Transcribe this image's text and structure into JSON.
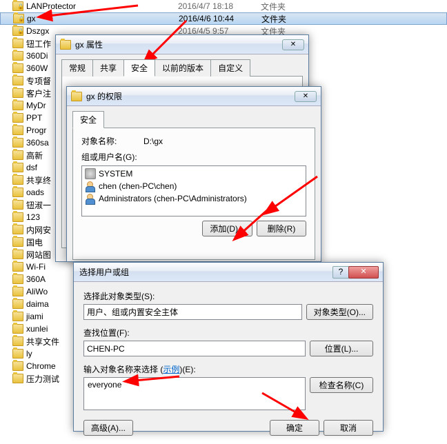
{
  "files": [
    {
      "name": "LANProtector",
      "date": "2016/4/7 18:18",
      "type": "文件夹",
      "locked": true
    },
    {
      "name": "gx",
      "date": "2016/4/6 10:44",
      "type": "文件夹",
      "selected": true,
      "locked": true
    },
    {
      "name": "Dszgx",
      "date": "2016/4/5 9:57",
      "type": "文件夹",
      "locked": true
    },
    {
      "name": "钮工作",
      "date": "",
      "type": ""
    },
    {
      "name": "360Di",
      "date": "",
      "type": ""
    },
    {
      "name": "360W",
      "date": "",
      "type": ""
    },
    {
      "name": "专项督",
      "date": "",
      "type": ""
    },
    {
      "name": "客户注",
      "date": "",
      "type": ""
    },
    {
      "name": "MyDr",
      "date": "",
      "type": ""
    },
    {
      "name": "PPT",
      "date": "",
      "type": ""
    },
    {
      "name": "Progr",
      "date": "",
      "type": ""
    },
    {
      "name": "360sa",
      "date": "",
      "type": ""
    },
    {
      "name": "高新",
      "date": "",
      "type": ""
    },
    {
      "name": "dsf",
      "date": "",
      "type": ""
    },
    {
      "name": "共享终",
      "date": "",
      "type": ""
    },
    {
      "name": "oads",
      "date": "",
      "type": ""
    },
    {
      "name": "钮淑一",
      "date": "",
      "type": ""
    },
    {
      "name": "123",
      "date": "",
      "type": ""
    },
    {
      "name": "内网安",
      "date": "",
      "type": ""
    },
    {
      "name": "国电",
      "date": "",
      "type": ""
    },
    {
      "name": "网站图",
      "date": "",
      "type": ""
    },
    {
      "name": "Wi-Fi",
      "date": "",
      "type": ""
    },
    {
      "name": "360A",
      "date": "",
      "type": ""
    },
    {
      "name": "AliWo",
      "date": "",
      "type": ""
    },
    {
      "name": "daima",
      "date": "",
      "type": ""
    },
    {
      "name": "jiami",
      "date": "",
      "type": ""
    },
    {
      "name": "xunlei",
      "date": "",
      "type": ""
    },
    {
      "name": "共享文件",
      "date": "",
      "type": ""
    },
    {
      "name": "ly",
      "date": "",
      "type": ""
    },
    {
      "name": "Chrome",
      "date": "",
      "type": ""
    },
    {
      "name": "压力测试",
      "date": "",
      "type": ""
    }
  ],
  "dlg1": {
    "title": "gx 属性",
    "tabs": {
      "general": "常规",
      "share": "共享",
      "security": "安全",
      "prev": "以前的版本",
      "custom": "自定义"
    },
    "close_glyph": "✕"
  },
  "dlg2": {
    "title": "gx 的权限",
    "tab_security": "安全",
    "object_label": "对象名称:",
    "object_value": "D:\\gx",
    "group_label": "组或用户名(G):",
    "users": [
      {
        "kind": "sys",
        "text": "SYSTEM"
      },
      {
        "kind": "user",
        "text": "chen (chen-PC\\chen)"
      },
      {
        "kind": "user",
        "text": "Administrators (chen-PC\\Administrators)"
      }
    ],
    "add_btn": "添加(D)...",
    "remove_btn": "删除(R)",
    "close_glyph": "✕"
  },
  "dlg3": {
    "title": "选择用户或组",
    "help_glyph": "?",
    "close_glyph": "✕",
    "objtype_label": "选择此对象类型(S):",
    "objtype_value": "用户、组或内置安全主体",
    "objtype_btn": "对象类型(O)...",
    "loc_label": "查找位置(F):",
    "loc_value": "CHEN-PC",
    "loc_btn": "位置(L)...",
    "names_label_prefix": "输入对象名称来选择 (",
    "names_label_link": "示例",
    "names_label_suffix": ")(E):",
    "names_value": "everyone",
    "check_btn": "检查名称(C)",
    "advanced_btn": "高级(A)...",
    "ok_btn": "确定",
    "cancel_btn": "取消"
  }
}
